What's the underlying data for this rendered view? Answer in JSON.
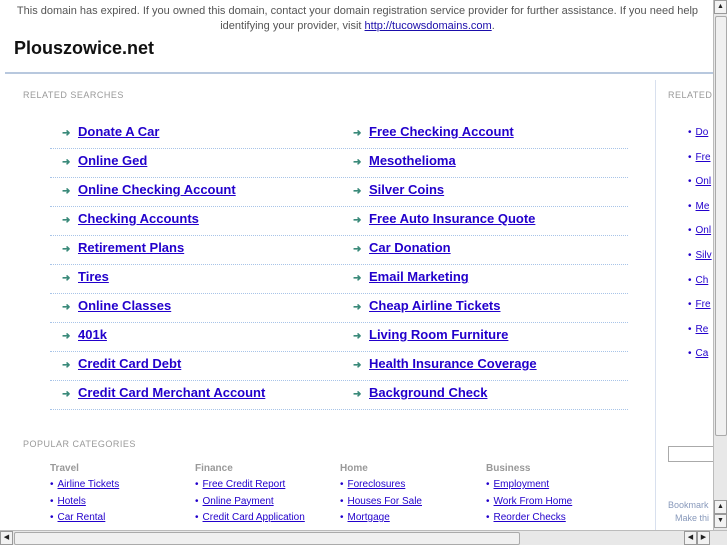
{
  "notice": {
    "text": "This domain has expired. If you owned this domain, contact your domain registration service provider for further assistance. If you need help identifying your provider, visit ",
    "link": "http://tucowsdomains.com",
    "end": "."
  },
  "title": "Plouszowice.net",
  "related_label": "RELATED SEARCHES",
  "related_side_label": "RELATED",
  "left_links": [
    "Donate A Car",
    "Online Ged",
    "Online Checking Account",
    "Checking Accounts",
    "Retirement Plans",
    "Tires",
    "Online Classes",
    "401k",
    "Credit Card Debt",
    "Credit Card Merchant Account"
  ],
  "right_links": [
    "Free Checking Account",
    "Mesothelioma",
    "Silver Coins",
    "Free Auto Insurance Quote",
    "Car Donation",
    "Email Marketing",
    "Cheap Airline Tickets",
    "Living Room Furniture",
    "Health Insurance Coverage",
    "Background Check"
  ],
  "side_links": [
    "Do",
    "Fre",
    "Onl",
    "Me",
    "Onl",
    "Silv",
    "Ch",
    "Fre",
    "Re",
    "Ca"
  ],
  "popular_label": "POPULAR CATEGORIES",
  "categories": [
    {
      "name": "Travel",
      "links": [
        "Airline Tickets",
        "Hotels",
        "Car Rental"
      ]
    },
    {
      "name": "Finance",
      "links": [
        "Free Credit Report",
        "Online Payment",
        "Credit Card Application"
      ]
    },
    {
      "name": "Home",
      "links": [
        "Foreclosures",
        "Houses For Sale",
        "Mortgage"
      ]
    },
    {
      "name": "Business",
      "links": [
        "Employment",
        "Work From Home",
        "Reorder Checks"
      ]
    }
  ],
  "bookmark": "Bookmark",
  "make": "Make thi",
  "colors": {
    "link": "#2200cc",
    "arrow": "#3a8a7a",
    "rule": "#b8c8de"
  }
}
